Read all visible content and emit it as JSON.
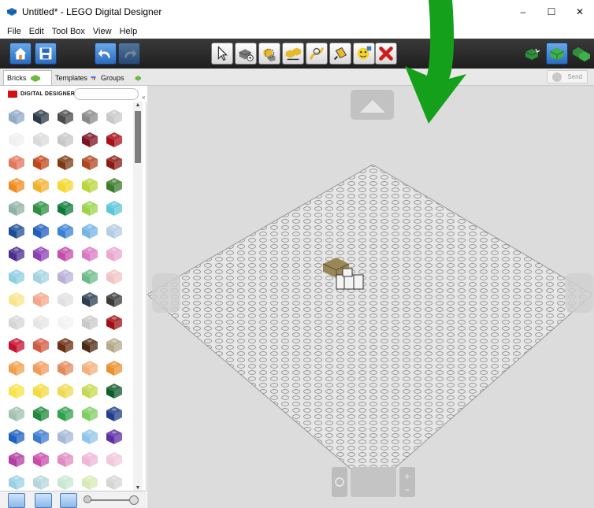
{
  "window": {
    "title": "Untitled* - LEGO Digital Designer",
    "minimize_label": "–",
    "maximize_label": "☐",
    "close_label": "✕"
  },
  "menu": {
    "items": [
      "File",
      "Edit",
      "Tool Box",
      "View",
      "Help"
    ]
  },
  "toolbar": {
    "tools": [
      {
        "name": "home-icon",
        "style": "blue"
      },
      {
        "name": "save-icon",
        "style": "blue"
      },
      {
        "name": "undo-icon",
        "style": "blue"
      },
      {
        "name": "redo-icon",
        "style": "blue"
      },
      {
        "name": "select-pointer-icon",
        "style": "white"
      },
      {
        "name": "clone-tool-icon",
        "style": "white"
      },
      {
        "name": "hinge-tool-icon",
        "style": "white"
      },
      {
        "name": "hinge-align-icon",
        "style": "white"
      },
      {
        "name": "flex-tool-icon",
        "style": "white"
      },
      {
        "name": "paint-bucket-icon",
        "style": "white"
      },
      {
        "name": "decoration-tool-icon",
        "style": "white"
      },
      {
        "name": "delete-tool-icon",
        "style": "white"
      },
      {
        "name": "build-mode-icon",
        "style": "dark"
      },
      {
        "name": "view-mode-icon",
        "style": "blue"
      },
      {
        "name": "building-guide-icon",
        "style": "dark"
      }
    ]
  },
  "tabs": {
    "bricks": "Bricks",
    "templates": "Templates",
    "groups": "Groups",
    "send": "Send"
  },
  "palette": {
    "brand": "DIGITAL DESIGNER",
    "search_value": "",
    "rows": [
      [
        "#8fa9c7",
        "#2b3a48",
        "#4b4b4b",
        "#8a8a8a",
        "#c8c8c8"
      ],
      [
        "#f0f0f0",
        "#dadada",
        "#c7c7c7",
        "#7a1322",
        "#a80f18"
      ],
      [
        "#e2775c",
        "#c14517",
        "#7d3a12",
        "#b0451f",
        "#8a1a14"
      ],
      [
        "#f28b1e",
        "#f5b02b",
        "#f6d72e",
        "#b9d53a",
        "#3a7c2a"
      ],
      [
        "#8fb3a2",
        "#2d8e3e",
        "#0c7a3a",
        "#9bd34b",
        "#5bc7d7"
      ],
      [
        "#1b4d96",
        "#1f5fbf",
        "#3a81d6",
        "#74b5e6",
        "#b3cde4"
      ],
      [
        "#4b2d8e",
        "#8c3fb7",
        "#c24ea9",
        "#d97bc4",
        "#e9a7cf"
      ],
      [
        "#8ccfe3",
        "#a2d4e0",
        "#b9b0d9",
        "#6bbb88",
        "#f1c4c4"
      ],
      [
        "#f6e58a",
        "#f5a58b",
        "#e0e0e0",
        "#2c3e50",
        "#3b3b3b"
      ],
      [
        "#d6d6d6",
        "#e6e6e6",
        "#f2f2f2",
        "#c9c9c9",
        "#a00f13"
      ],
      [
        "#c8102e",
        "#d2583f",
        "#6b2e10",
        "#4b2a12",
        "#b5a98a"
      ],
      [
        "#f0a04b",
        "#f49a5a",
        "#e3895c",
        "#f3b07b",
        "#e8922f"
      ],
      [
        "#f7e34a",
        "#f4d93f",
        "#eed952",
        "#c7d94f",
        "#0f5e2c"
      ],
      [
        "#a1c2b0",
        "#1f8a3c",
        "#2fa14c",
        "#7ecf63",
        "#1f3f8a"
      ],
      [
        "#1f61c0",
        "#3a7bd1",
        "#a6b7d8",
        "#8fc5ea",
        "#5c2fa5"
      ],
      [
        "#b33ba3",
        "#cb4bab",
        "#e08bc2",
        "#efb6d7",
        "#f1c8dc"
      ],
      [
        "#9ad0e6",
        "#b5d6dc",
        "#c7e7d1",
        "#d9e9b6",
        "#d5d5d5"
      ]
    ]
  },
  "colors": {
    "accent_green": "#14a01a",
    "canvas_bg": "#dcdcdc",
    "toolbar_bg": "#2a2a2a"
  }
}
